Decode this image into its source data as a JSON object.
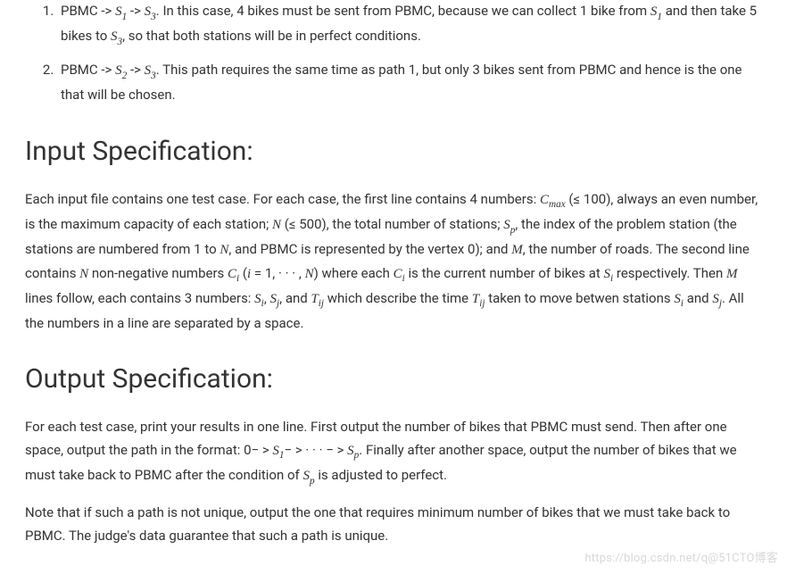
{
  "list": {
    "items": [
      {
        "html": "PBMC -> <span class=\"math\">S</span><span class=\"sub\">1</span> -> <span class=\"math\">S</span><span class=\"sub\">3</span>. In this case, 4 bikes must be sent from PBMC, because we can collect 1 bike from <span class=\"math\">S</span><span class=\"sub\">1</span> and then take 5 bikes to <span class=\"math\">S</span><span class=\"sub\">3</span>, so that both stations will be in perfect conditions."
      },
      {
        "html": "PBMC -> <span class=\"math\">S</span><span class=\"sub\">2</span> -> <span class=\"math\">S</span><span class=\"sub\">3</span>. This path requires the same time as path 1, but only 3 bikes sent from PBMC and hence is the one that will be chosen."
      }
    ]
  },
  "sections": {
    "input": {
      "title": "Input Specification:",
      "body_html": "Each input file contains one test case. For each case, the first line contains 4 numbers: <span class=\"math\">C</span><span class=\"sub\">max</span> (≤ 100), always an even number, is the maximum capacity of each station; <span class=\"math\">N</span> (≤ 500), the total number of stations; <span class=\"math\">S</span><span class=\"sub\">p</span>, the index of the problem station (the stations are numbered from 1 to <span class=\"math\">N</span>, and PBMC is represented by the vertex 0); and <span class=\"math\">M</span>, the number of roads. The second line contains <span class=\"math\">N</span> non-negative numbers <span class=\"math\">C</span><span class=\"sub\">i</span> (<span class=\"math\">i</span> = 1,&nbsp;·&nbsp;·&nbsp;·&nbsp;, <span class=\"math\">N</span>) where each <span class=\"math\">C</span><span class=\"sub\">i</span> is the current number of bikes at <span class=\"math\">S</span><span class=\"sub\">i</span> respectively. Then <span class=\"math\">M</span> lines follow, each contains 3 numbers: <span class=\"math\">S</span><span class=\"sub\">i</span>, <span class=\"math\">S</span><span class=\"sub\">j</span>, and <span class=\"math\">T</span><span class=\"sub\">ij</span> which describe the time <span class=\"math\">T</span><span class=\"sub\">ij</span> taken to move betwen stations <span class=\"math\">S</span><span class=\"sub\">i</span> and <span class=\"math\">S</span><span class=\"sub\">j</span>. All the numbers in a line are separated by a space."
    },
    "output": {
      "title": "Output Specification:",
      "body_html": "For each test case, print your results in one line. First output the number of bikes that PBMC must send. Then after one space, output the path in the format: 0−&nbsp;&gt; <span class=\"math\">S</span><span class=\"sub\">1</span>−&nbsp;&gt;&nbsp;·&nbsp;·&nbsp;·&nbsp;−&nbsp;&gt; <span class=\"math\">S</span><span class=\"sub\">p</span>. Finally after another space, output the number of bikes that we must take back to PBMC after the condition of <span class=\"math\">S</span><span class=\"sub\">p</span> is adjusted to perfect.",
      "note": "Note that if such a path is not unique, output the one that requires minimum number of bikes that we must take back to PBMC. The judge's data guarantee that such a path is unique."
    }
  },
  "watermark": "https://blog.csdn.net/q@51CTO博客"
}
